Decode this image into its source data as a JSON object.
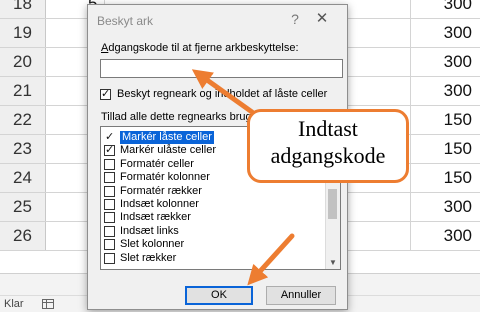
{
  "sheet": {
    "rows": [
      {
        "num": "18",
        "frag": "5",
        "value": "300"
      },
      {
        "num": "19",
        "frag": "5",
        "value": "300"
      },
      {
        "num": "20",
        "frag": "5",
        "value": "300"
      },
      {
        "num": "21",
        "frag": "5",
        "value": "300"
      },
      {
        "num": "22",
        "frag": "5",
        "value": "150"
      },
      {
        "num": "23",
        "frag": "5",
        "value": "150"
      },
      {
        "num": "24",
        "frag": "5",
        "value": "150"
      },
      {
        "num": "25",
        "frag": "5",
        "value": "300"
      },
      {
        "num": "26",
        "frag": "5",
        "value": "300"
      }
    ]
  },
  "status": {
    "text": "Klar"
  },
  "dialog": {
    "title": "Beskyt ark",
    "help": "?",
    "close": "✕",
    "password_label_first": "A",
    "password_label_rest": "dgangskode til at fjerne arkbeskyttelse:",
    "password_value": "",
    "protect_label": "Beskyt regneark og indholdet af låste celler",
    "protect_checked": true,
    "allow_label": "Tillad alle dette regnearks brugere at:",
    "permissions": [
      {
        "label": "Markér låste celler",
        "checked": true,
        "selected": true
      },
      {
        "label": "Markér ulåste celler",
        "checked": true,
        "selected": false
      },
      {
        "label": "Formatér celler",
        "checked": false,
        "selected": false
      },
      {
        "label": "Formatér kolonner",
        "checked": false,
        "selected": false
      },
      {
        "label": "Formatér rækker",
        "checked": false,
        "selected": false
      },
      {
        "label": "Indsæt kolonner",
        "checked": false,
        "selected": false
      },
      {
        "label": "Indsæt rækker",
        "checked": false,
        "selected": false
      },
      {
        "label": "Indsæt links",
        "checked": false,
        "selected": false
      },
      {
        "label": "Slet kolonner",
        "checked": false,
        "selected": false
      },
      {
        "label": "Slet rækker",
        "checked": false,
        "selected": false
      }
    ],
    "ok_label": "OK",
    "cancel_label": "Annuller"
  },
  "callout": {
    "line1": "Indtast",
    "line2": "adgangskode",
    "color": "#ed7d31"
  },
  "icons": {
    "status_icon": "sheet-layout-icon",
    "scroll_up": "chevron-up-icon",
    "scroll_down": "chevron-down-icon"
  }
}
